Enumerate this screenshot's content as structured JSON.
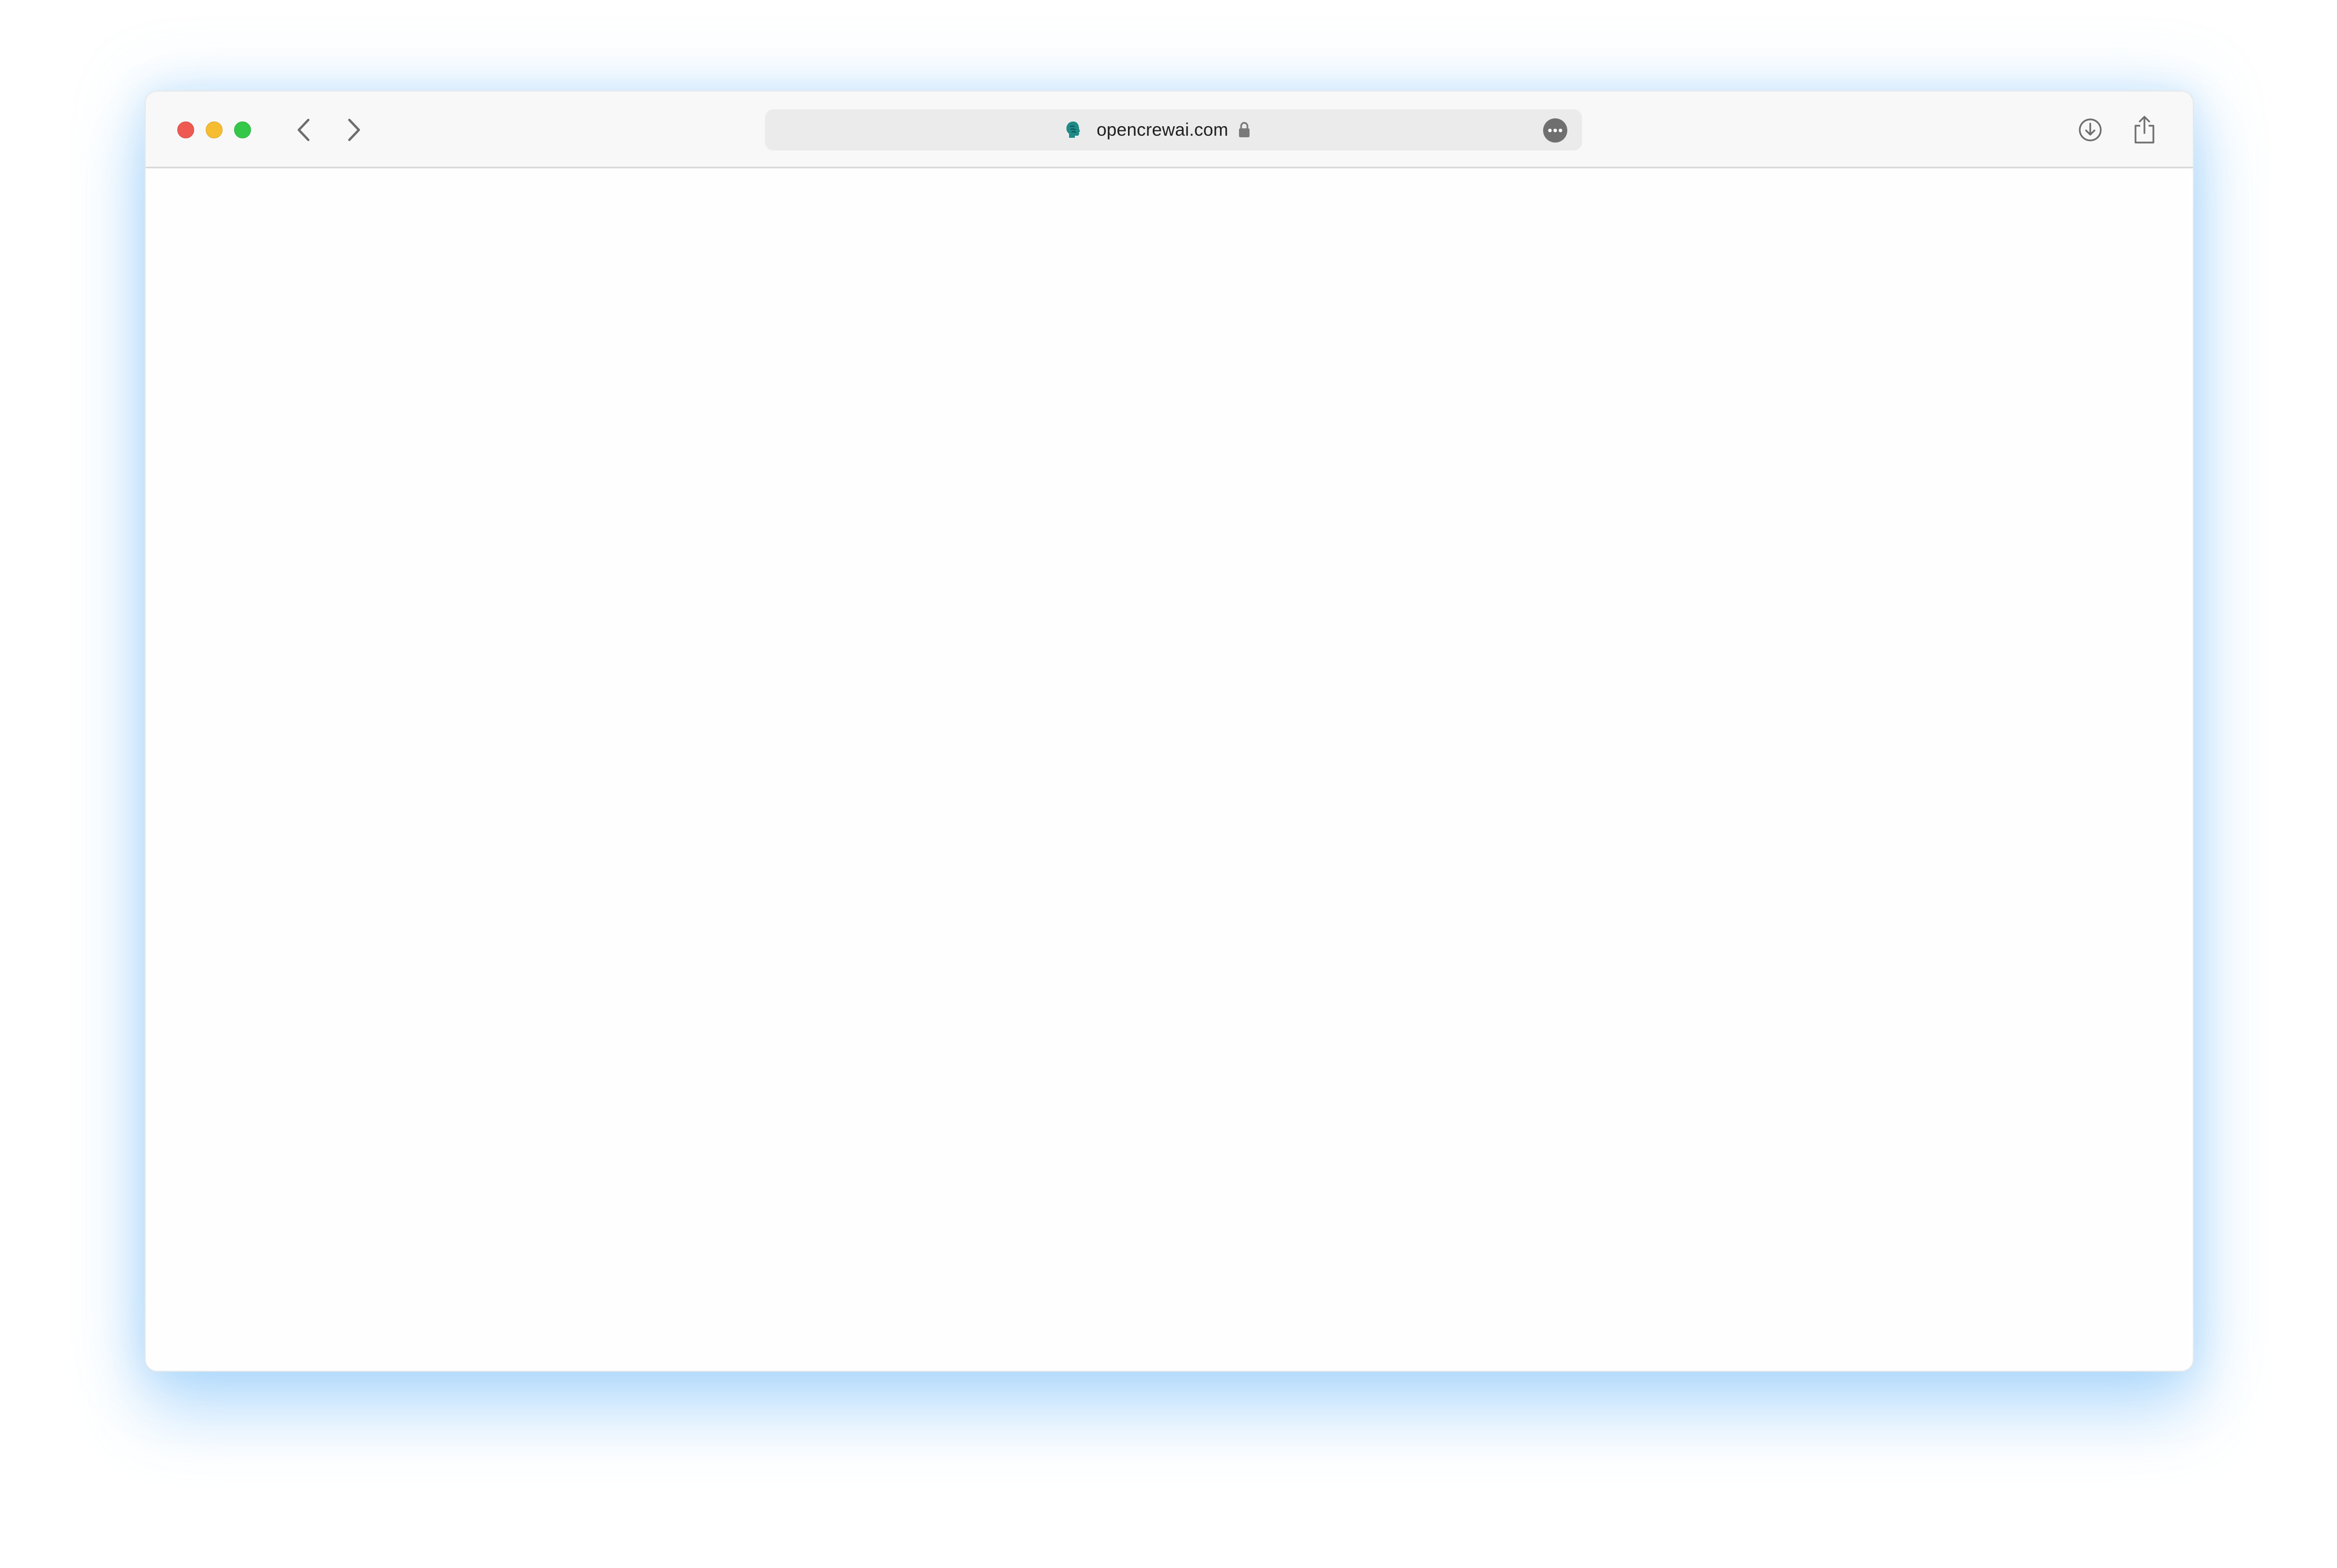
{
  "browser": {
    "address_bar": {
      "url": "opencrewai.com",
      "secure": true
    },
    "icons": {
      "favicon": "brain-head-icon",
      "lock": "lock-icon",
      "more": "ellipsis-circle-icon",
      "back": "chevron-left-icon",
      "forward": "chevron-right-icon",
      "download": "download-circle-icon",
      "share": "share-icon"
    },
    "colors": {
      "close": "#ee5a52",
      "minimize": "#f5bd2f",
      "zoom": "#35c848",
      "favicon": "#1f8a86",
      "glow": "#bfe0fb"
    }
  },
  "page": {
    "content": ""
  }
}
